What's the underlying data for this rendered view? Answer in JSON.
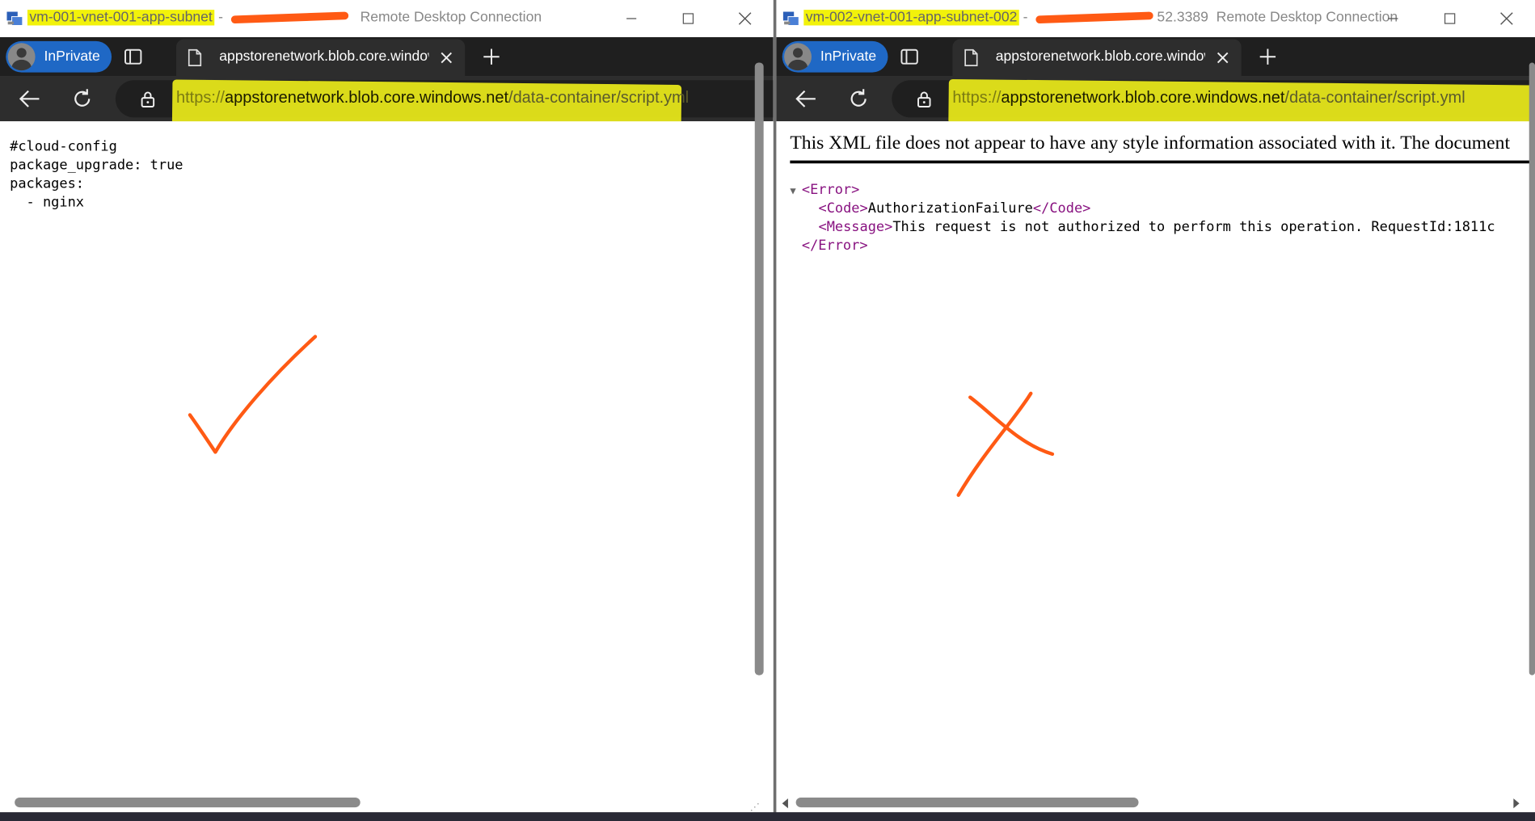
{
  "left_window": {
    "title_vm": "vm-001-vnet-001-app-subnet",
    "title_sep": "-",
    "title_app": "Remote Desktop Connection",
    "browser": {
      "inprivate_label": "InPrivate",
      "tab_title": "appstorenetwork.blob.core.windows.net/data-container/script.yml",
      "url_proto": "https://",
      "url_host": "appstorenetwork.blob.core.windows.net",
      "url_path": "/data-container/script.yml"
    },
    "content_lines": [
      "#cloud-config",
      "package_upgrade: true",
      "packages:",
      "  - nginx"
    ],
    "annotation": "checkmark"
  },
  "right_window": {
    "title_vm": "vm-002-vnet-001-app-subnet-002",
    "title_sep": "-",
    "title_suffix": "52.3389",
    "title_app": "Remote Desktop Connection",
    "browser": {
      "inprivate_label": "InPrivate",
      "tab_title": "appstorenetwork.blob.core.windows.net/data-container/script.yml",
      "url_proto": "https://",
      "url_host": "appstorenetwork.blob.core.windows.net",
      "url_path": "/data-container/script.yml"
    },
    "xml_notice": "This XML file does not appear to have any style information associated with it. The document",
    "xml": {
      "error_open": "<Error>",
      "code_open": "<Code>",
      "code_value": "AuthorizationFailure",
      "code_close": "</Code>",
      "message_open": "<Message>",
      "message_value": "This request is not authorized to perform this operation. RequestId:1811c",
      "error_close": "</Error>"
    },
    "annotation": "cross"
  },
  "colors": {
    "highlight": "#f2f20a",
    "annotation": "#ff5a14",
    "inprivate": "#1f68c5",
    "xml_tag": "#881280"
  }
}
